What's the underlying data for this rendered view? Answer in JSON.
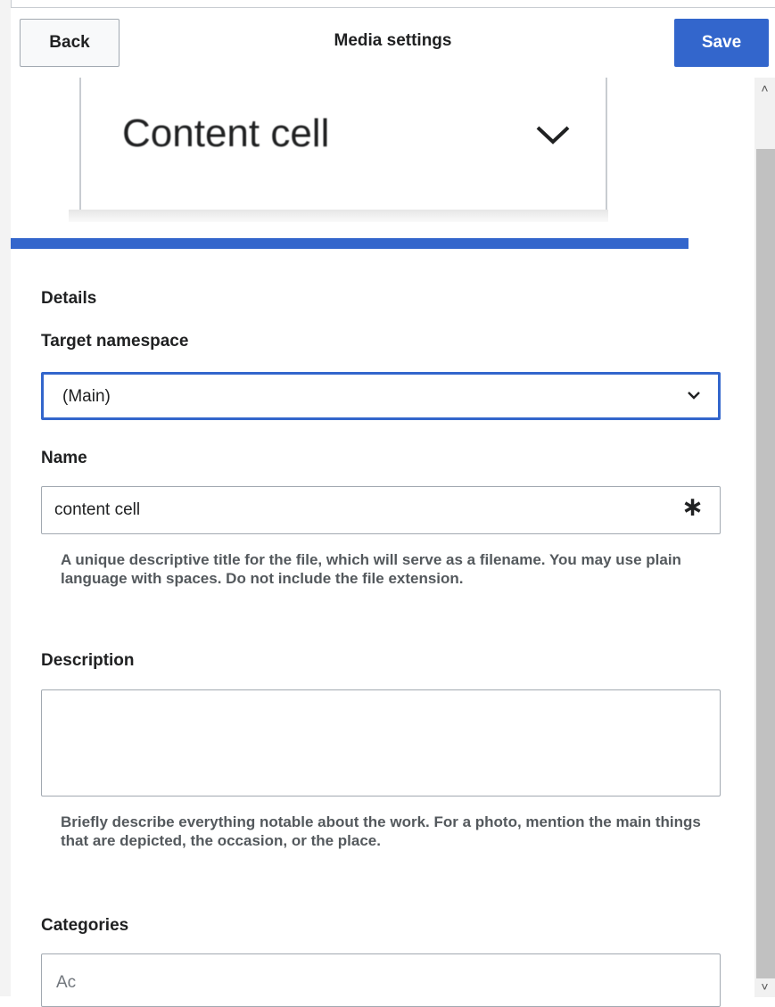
{
  "header": {
    "back_label": "Back",
    "title": "Media settings",
    "save_label": "Save"
  },
  "preview": {
    "text": "Content cell"
  },
  "form": {
    "section_title": "Details",
    "target_namespace": {
      "label": "Target namespace",
      "value": "(Main)"
    },
    "name": {
      "label": "Name",
      "value": "content cell",
      "required_mark": "∗",
      "help": "A unique descriptive title for the file, which will serve as a filename. You may use plain language with spaces. Do not include the file extension."
    },
    "description": {
      "label": "Description",
      "value": "",
      "help": "Briefly describe everything notable about the work. For a photo, mention the main things that are depicted, the occasion, or the place."
    },
    "categories": {
      "label": "Categories",
      "placeholder": "Ac"
    }
  },
  "colors": {
    "accent": "#3366cc",
    "help_text": "#54595d",
    "border": "#a2a9b1"
  }
}
